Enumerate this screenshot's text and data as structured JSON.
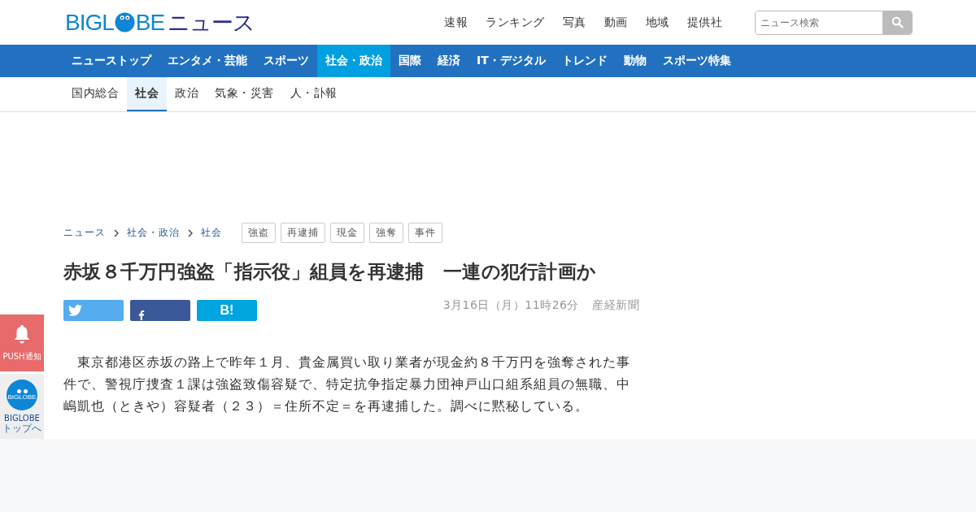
{
  "logo": {
    "left": "BIGL",
    "right": "BE",
    "suffix": "ニュース"
  },
  "header_links": [
    "速報",
    "ランキング",
    "写真",
    "動画",
    "地域",
    "提供社"
  ],
  "search": {
    "placeholder": "ニュース検索"
  },
  "main_nav": [
    {
      "label": "ニューストップ",
      "selected": false
    },
    {
      "label": "エンタメ・芸能",
      "selected": false
    },
    {
      "label": "スポーツ",
      "selected": false
    },
    {
      "label": "社会・政治",
      "selected": true
    },
    {
      "label": "国際",
      "selected": false
    },
    {
      "label": "経済",
      "selected": false
    },
    {
      "label": "IT・デジタル",
      "selected": false
    },
    {
      "label": "トレンド",
      "selected": false
    },
    {
      "label": "動物",
      "selected": false
    },
    {
      "label": "スポーツ特集",
      "selected": false
    }
  ],
  "sub_nav": [
    {
      "label": "国内総合",
      "selected": false
    },
    {
      "label": "社会",
      "selected": true
    },
    {
      "label": "政治",
      "selected": false
    },
    {
      "label": "気象・災害",
      "selected": false
    },
    {
      "label": "人・訃報",
      "selected": false
    }
  ],
  "breadcrumb": [
    "ニュース",
    "社会・政治",
    "社会"
  ],
  "tags": [
    "強盗",
    "再逮捕",
    "現金",
    "強奪",
    "事件"
  ],
  "article": {
    "title": "赤坂８千万円強盗「指示役」組員を再逮捕　一連の犯行計画か",
    "share_buttons": [
      {
        "kind": "twitter"
      },
      {
        "kind": "facebook"
      },
      {
        "kind": "hatena",
        "label": "B!"
      }
    ],
    "date": "3月16日（月）11時26分",
    "source": "産経新聞",
    "body": "　東京都港区赤坂の路上で昨年１月、貴金属買い取り業者が現金約８千万円を強奪された事件で、警視庁捜査１課は強盗致傷容疑で、特定抗争指定暴力団神戸山口組系組員の無職、中嶋凱也（ときや）容疑者（２３）＝住所不定＝を再逮捕した。調べに黙秘している。"
  },
  "side": {
    "push_label": "PUSH通知",
    "top_badge": "BIGLOBE",
    "top_title": "BIGLOBE",
    "top_sub": "トップへ"
  }
}
